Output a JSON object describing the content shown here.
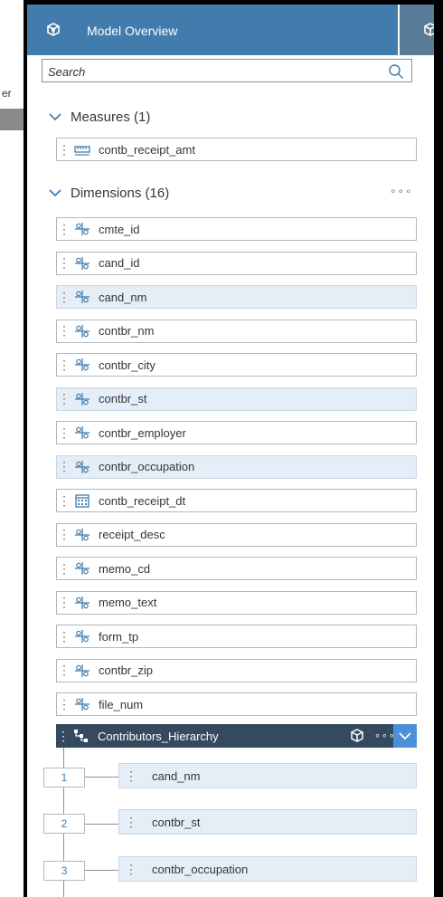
{
  "header": {
    "title": "Model Overview",
    "icon": "cube-icon",
    "right_icon": "cube-icon",
    "background_color": "#427cac"
  },
  "left_edge": {
    "glyph": "er"
  },
  "search": {
    "placeholder": "Search",
    "value": ""
  },
  "measures": {
    "title": "Measures (1)",
    "items": [
      {
        "label": "contb_receipt_amt",
        "icon": "measure-icon",
        "selected": false
      }
    ]
  },
  "dimensions": {
    "title": "Dimensions (16)",
    "more_label": "∘∘∘",
    "items": [
      {
        "label": "cmte_id",
        "icon": "dimension-icon",
        "selected": false
      },
      {
        "label": "cand_id",
        "icon": "dimension-icon",
        "selected": false
      },
      {
        "label": "cand_nm",
        "icon": "dimension-icon",
        "selected": true
      },
      {
        "label": "contbr_nm",
        "icon": "dimension-icon",
        "selected": false
      },
      {
        "label": "contbr_city",
        "icon": "dimension-icon",
        "selected": false
      },
      {
        "label": "contbr_st",
        "icon": "dimension-icon",
        "selected": true
      },
      {
        "label": "contbr_employer",
        "icon": "dimension-icon",
        "selected": false
      },
      {
        "label": "contbr_occupation",
        "icon": "dimension-icon",
        "selected": true
      },
      {
        "label": "contb_receipt_dt",
        "icon": "calendar-icon",
        "selected": false
      },
      {
        "label": "receipt_desc",
        "icon": "dimension-icon",
        "selected": false
      },
      {
        "label": "memo_cd",
        "icon": "dimension-icon",
        "selected": false
      },
      {
        "label": "memo_text",
        "icon": "dimension-icon",
        "selected": false
      },
      {
        "label": "form_tp",
        "icon": "dimension-icon",
        "selected": false
      },
      {
        "label": "contbr_zip",
        "icon": "dimension-icon",
        "selected": false
      },
      {
        "label": "file_num",
        "icon": "dimension-icon",
        "selected": false
      }
    ]
  },
  "hierarchy": {
    "label": "Contributors_Hierarchy",
    "icon": "hierarchy-icon",
    "more_label": "∘∘∘",
    "background_color": "#354a5f",
    "levels": [
      {
        "number": "1",
        "label": "cand_nm"
      },
      {
        "number": "2",
        "label": "contbr_st"
      },
      {
        "number": "3",
        "label": "contbr_occupation"
      }
    ]
  }
}
